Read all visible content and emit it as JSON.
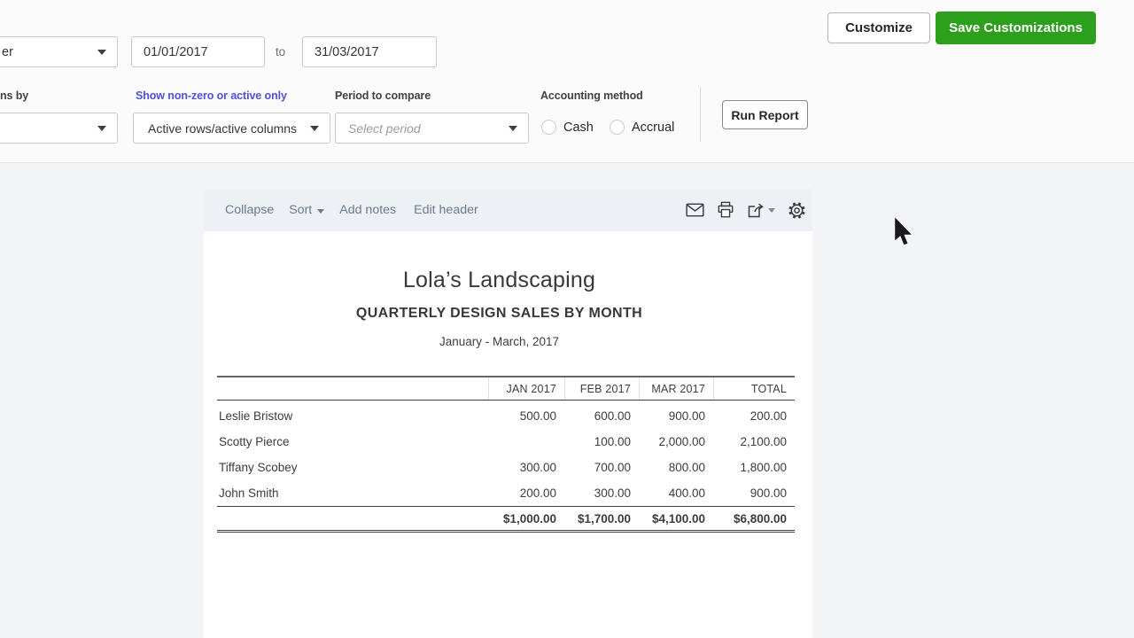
{
  "filters": {
    "period_select_value": "er",
    "date_from": "01/01/2017",
    "date_to_label": "to",
    "date_to": "31/03/2017",
    "columns_by_label": "ns by",
    "show_nonzero_label": "Show non-zero or active only",
    "rows_columns_value": "Active rows/active columns",
    "period_compare_label": "Period to compare",
    "period_compare_placeholder": "Select period",
    "accounting_method_label": "Accounting method",
    "cash_label": "Cash",
    "accrual_label": "Accrual",
    "run_report_label": "Run Report",
    "customize_label": "Customize",
    "save_customizations_label": "Save Customizations"
  },
  "report_toolbar": {
    "links": [
      "Collapse",
      "Sort",
      "Add notes",
      "Edit header"
    ]
  },
  "report": {
    "company": "Lola’s Landscaping",
    "title": "QUARTERLY DESIGN SALES BY MONTH",
    "period": "January - March, 2017"
  },
  "chart_data": {
    "type": "table",
    "title": "QUARTERLY DESIGN SALES BY MONTH",
    "columns": [
      "JAN 2017",
      "FEB 2017",
      "MAR 2017",
      "TOTAL"
    ],
    "rows": [
      {
        "name": "Leslie Bristow",
        "values": [
          "500.00",
          "600.00",
          "900.00",
          "200.00"
        ]
      },
      {
        "name": "Scotty Pierce",
        "values": [
          "",
          "100.00",
          "2,000.00",
          "2,100.00"
        ]
      },
      {
        "name": "Tiffany Scobey",
        "values": [
          "300.00",
          "700.00",
          "800.00",
          "1,800.00"
        ]
      },
      {
        "name": "John Smith",
        "values": [
          "200.00",
          "300.00",
          "400.00",
          "900.00"
        ]
      }
    ],
    "totals": [
      "$1,000.00",
      "$1,700.00",
      "$4,100.00",
      "$6,800.00"
    ]
  },
  "colors": {
    "accent_green": "#2ca01c",
    "link_violet": "#5051d6",
    "toolbar_link": "#6b7a8d"
  }
}
